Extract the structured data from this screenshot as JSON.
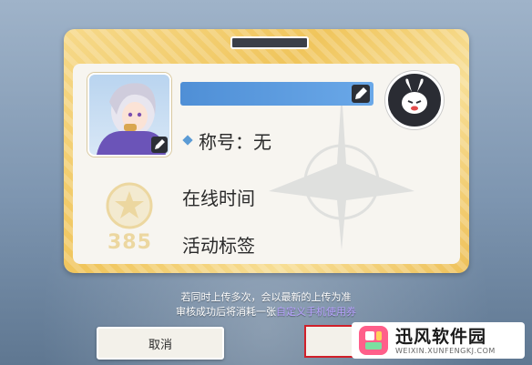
{
  "profile": {
    "title_label": "称号：无",
    "level": "385",
    "online_time_label": "在线时间",
    "activity_tag_label": "活动标签"
  },
  "notice": {
    "line1": "若同时上传多次，会以最新的上传为准",
    "line2_prefix": "审核成功后将消耗一张",
    "line2_ticket": "自定义手机使用券"
  },
  "buttons": {
    "cancel_label": "取消"
  },
  "watermark": {
    "title": "迅风软件园",
    "url": "WEIXIN.XUNFENGKJ.COM"
  },
  "colors": {
    "accent_blue": "#5b9bd5",
    "frame_gold": "#f0c55c",
    "ticket_purple": "#b8a2ff",
    "highlight_red": "#d0202a"
  }
}
